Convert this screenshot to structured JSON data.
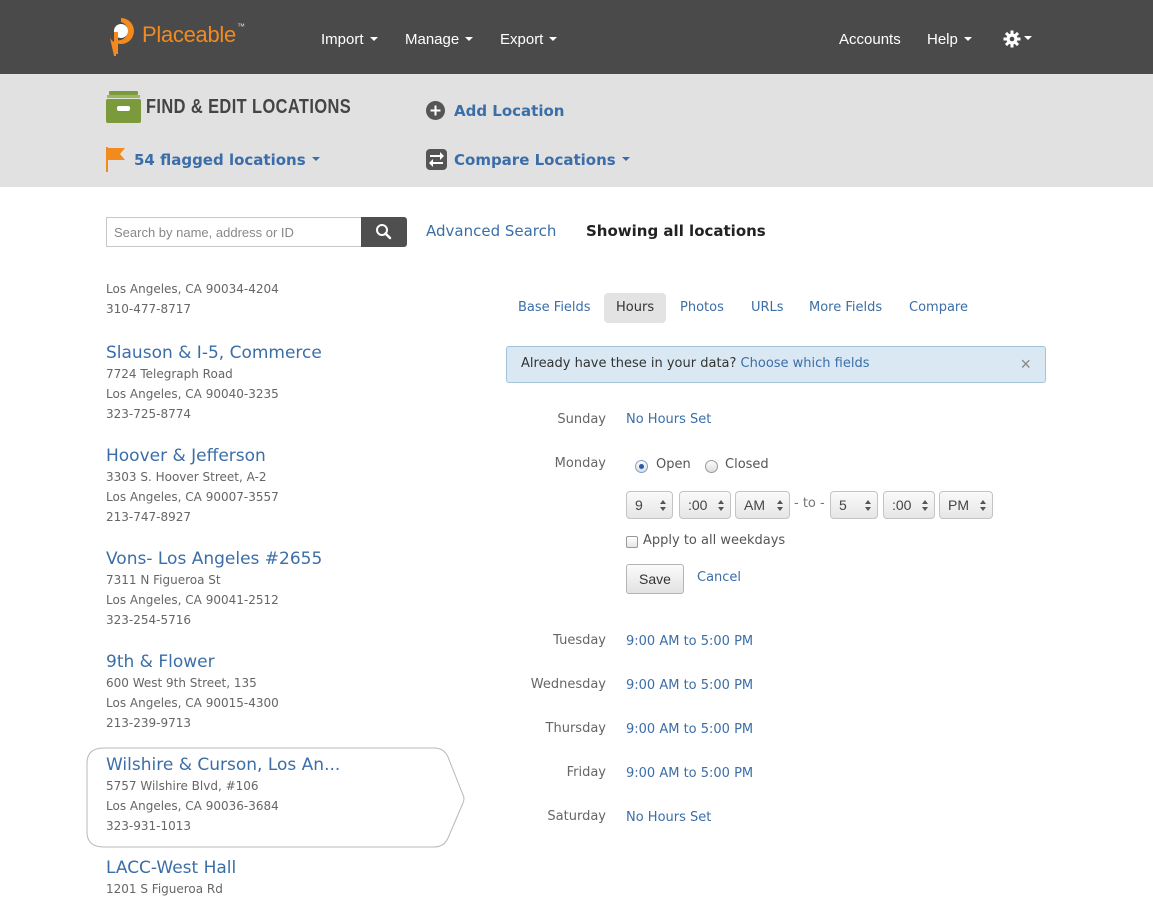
{
  "app": {
    "logo_text": "Placeable",
    "logo_tm": "™"
  },
  "nav": {
    "import": "Import",
    "manage": "Manage",
    "export": "Export",
    "accounts": "Accounts",
    "help": "Help",
    "settings_icon": "gear-icon"
  },
  "subheader": {
    "title": "FIND & EDIT LOCATIONS",
    "add_location": "Add Location",
    "flagged": "54 flagged locations",
    "compare": "Compare Locations"
  },
  "search": {
    "placeholder": "Search by name, address or ID",
    "value": "",
    "advanced": "Advanced Search",
    "showing": "Showing all locations"
  },
  "locations": [
    {
      "name": "",
      "address": "",
      "city": "Los Angeles, CA 90034-4204",
      "phone": "310-477-8717"
    },
    {
      "name": "Slauson & I-5, Commerce",
      "address": "7724 Telegraph Road",
      "city": "Los Angeles, CA 90040-3235",
      "phone": "323-725-8774"
    },
    {
      "name": "Hoover & Jefferson",
      "address": "3303 S. Hoover Street, A-2",
      "city": "Los Angeles, CA 90007-3557",
      "phone": "213-747-8927"
    },
    {
      "name": "Vons- Los Angeles #2655",
      "address": "7311 N Figueroa St",
      "city": "Los Angeles, CA 90041-2512",
      "phone": "323-254-5716"
    },
    {
      "name": "9th & Flower",
      "address": "600 West 9th Street, 135",
      "city": "Los Angeles, CA 90015-4300",
      "phone": "213-239-9713"
    },
    {
      "name": "Wilshire & Curson, Los An...",
      "address": "5757 Wilshire Blvd, #106",
      "city": "Los Angeles, CA 90036-3684",
      "phone": "323-931-1013",
      "selected": true
    },
    {
      "name": "LACC-West Hall",
      "address": "1201 S Figueroa Rd",
      "city": "",
      "phone": ""
    }
  ],
  "tabs": [
    "Base Fields",
    "Hours",
    "Photos",
    "URLs",
    "More Fields",
    "Compare"
  ],
  "active_tab": "Hours",
  "alert": {
    "text": "Already have these in your data?",
    "link": "Choose which fields",
    "close": "×"
  },
  "hours": {
    "sunday": {
      "label": "Sunday",
      "value": "No Hours Set"
    },
    "monday": {
      "label": "Monday",
      "open_label": "Open",
      "closed_label": "Closed",
      "status": "open",
      "from_hour": "9",
      "from_min": ":00",
      "from_ampm": "AM",
      "to_text": "- to -",
      "to_hour": "5",
      "to_min": ":00",
      "to_ampm": "PM",
      "apply_all": "Apply to all weekdays",
      "save": "Save",
      "cancel": "Cancel"
    },
    "tuesday": {
      "label": "Tuesday",
      "value": "9:00 AM to 5:00 PM"
    },
    "wednesday": {
      "label": "Wednesday",
      "value": "9:00 AM to 5:00 PM"
    },
    "thursday": {
      "label": "Thursday",
      "value": "9:00 AM to 5:00 PM"
    },
    "friday": {
      "label": "Friday",
      "value": "9:00 AM to 5:00 PM"
    },
    "saturday": {
      "label": "Saturday",
      "value": "No Hours Set"
    }
  },
  "colors": {
    "topbar": "#4a4a4a",
    "subbar": "#e1e1e1",
    "link": "#3b6ea8",
    "brand": "#f28a1e",
    "box_icon": "#7a9a3c",
    "flag": "#f28a1e"
  }
}
